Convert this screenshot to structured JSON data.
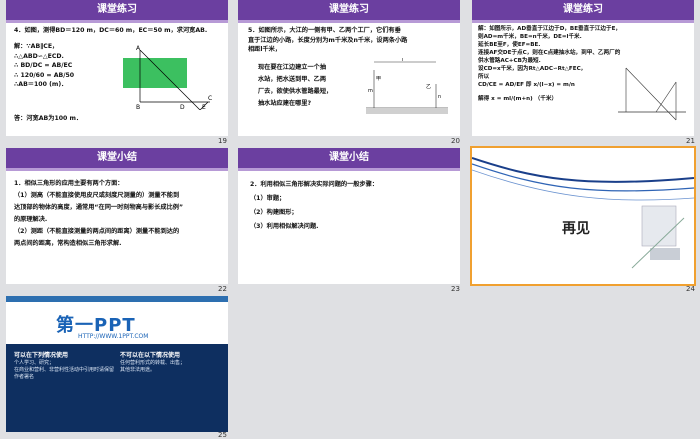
{
  "slides": [
    {
      "number": "19",
      "header": "课堂练习",
      "lines": [
        "4．如图，测得BD＝120 m，DC＝60 m，EC＝50 m，求河宽AB.",
        "解：∵AB∥CE，",
        "∴△ABD∽△ECD.",
        "∴ BD/DC = AB/EC",
        "∴ 120/60 = AB/50",
        "∴AB＝100 (m)．",
        "答：河宽AB为100 m．"
      ],
      "labels": {
        "A": "A",
        "B": "B",
        "D": "D",
        "C": "C",
        "E": "E"
      }
    },
    {
      "number": "20",
      "header": "课堂练习",
      "lines": [
        "5．如图所示，大江的一侧有甲、乙两个工厂，它们有垂",
        "直于江边的小路，长度分别为m千米及n千米，设两条小路",
        "相距l千米，",
        "现在要在江边建立一个抽",
        "水站，把水送到甲、乙两",
        "厂去，欲使供水管路最短，",
        "抽水站应建在哪里?"
      ],
      "labels": {
        "jia": "甲",
        "yi": "乙",
        "l": "l",
        "m": "m",
        "n": "n"
      }
    },
    {
      "number": "21",
      "header": "课堂练习",
      "lines": [
        "解：如图所示，AD垂直于江边于D，BE垂直于江边于E，",
        "则AD=m千米，BE=n千米，DE=l千米.",
        "延长BE至F，使EF=BE.",
        "连接AF交DE于点C，则在C点建抽水站，到甲、乙两厂的",
        "供水管路AC+CB为最短.",
        "设CD=x千米，因为Rt△ADC∽Rt△FEC，",
        "所以",
        "CD/CE = AD/EF 即 x/(l−x) = m/n",
        "解得 x = ml/(m+n) （千米）"
      ]
    },
    {
      "number": "22",
      "header": "课堂小结",
      "lines": [
        "1．相似三角形的应用主要有两个方面：",
        "（1）测高（不能直接使用皮尺或刻度尺测量的）测量不能到",
        "达顶部的物体的高度，通常用“在同一时刻物高与影长成比例”",
        "的原理解决.",
        "（2）测距（不能直接测量的两点间的距离）测量不能到达的",
        "两点间的距离，常构造相似三角形求解."
      ]
    },
    {
      "number": "23",
      "header": "课堂小结",
      "lines": [
        "2．利用相似三角形解决实际问题的一般步骤：",
        "（1）审题；",
        "（2）构建图形；",
        "（3）利用相似解决问题."
      ]
    },
    {
      "number": "24",
      "title": "再见"
    },
    {
      "number": "25",
      "logo": "第一PPT",
      "site": "HTTP://WWW.1PPT.COM",
      "left_title": "可以在下列情况使用",
      "left_lines": [
        "个人学习、研究；",
        "在商业和营利、非营利性活动中引用时请保留作者署名"
      ],
      "right_title": "不可以在以下情况使用",
      "right_lines": [
        "任何营利形式的转载、出售；",
        "其他非法用途。"
      ]
    }
  ],
  "colors": {
    "header": "#6b3fa0",
    "strip": "#b79ad6",
    "selected": "#f0a030",
    "logo": "#1a63b6"
  }
}
